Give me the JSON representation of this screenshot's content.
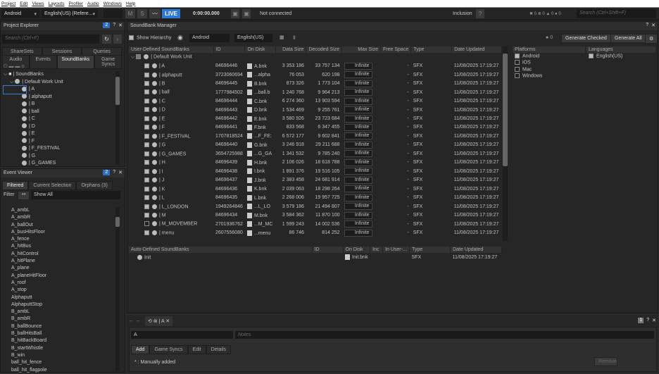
{
  "menu": [
    "Project",
    "Edit",
    "Views",
    "Layouts",
    "Profiler",
    "Audio",
    "Windows",
    "Help"
  ],
  "toolbar": {
    "platform": "Android",
    "language": "English(US) (Refere...",
    "m": "M",
    "s": "S",
    "live": "LIVE",
    "time": "0:00:00.000",
    "status": "Not connected",
    "inclusion": "Inclusion",
    "inclusion_btn": "?",
    "counts": [
      "0",
      "0",
      "0",
      "0"
    ],
    "search_placeholder": "Search (Ctrl+Shift+F)"
  },
  "project_explorer": {
    "title": "Project Explorer",
    "badge": "2",
    "search_placeholder": "Search (Ctrl+F)",
    "tabs_row1": [
      "ShareSets",
      "Sessions",
      "Queries"
    ],
    "tabs_row2": [
      "Audio",
      "Events",
      "SoundBanks",
      "Game Syncs"
    ],
    "active_tab": "SoundBanks",
    "root": "SoundBanks",
    "work_unit": "Default Work Unit",
    "items": [
      "A",
      "alphaputt",
      "B",
      "ball",
      "C",
      "D",
      "E",
      "F",
      "F_FESTIVAL",
      "G",
      "G_GAMES"
    ]
  },
  "event_viewer": {
    "title": "Event Viewer",
    "badge": "2",
    "tabs": [
      "Filtered",
      "Current Selection",
      "Orphans (3)"
    ],
    "filter_label": "Filter",
    "filter_btn": "**",
    "filter_value": "Show All",
    "events": [
      "A_ambL",
      "A_ambR",
      "A_ballOut",
      "A_busHitsFloor",
      "A_fence",
      "A_hitBus",
      "A_hitControl",
      "A_hitPlane",
      "A_plane",
      "A_planeHitFloor",
      "A_roof",
      "A_stop",
      "Alphaputt",
      "AlphaputtStop",
      "B_ambL",
      "B_ambR",
      "B_ballBounce",
      "B_ballHitsBall",
      "B_hitBackBoard",
      "B_startWhistle",
      "B_win",
      "ball_hit_fence",
      "ball_hit_flagpole"
    ]
  },
  "soundbank_manager": {
    "title": "SoundBank Manager",
    "show_hierarchy": "Show Hierarchy",
    "platform": "Android",
    "language": "English(US)",
    "info_count": "0",
    "generate_checked": "Generate Checked",
    "generate_all": "Generate All",
    "columns": [
      "User-Defined SoundBanks",
      "ID",
      "On Disk",
      "Data Size",
      "Decoded Size",
      "Max Size",
      "Free Space",
      "Type",
      "Date Updated"
    ],
    "work_unit": "Default Work Unit",
    "rows": [
      [
        "A",
        "84696446",
        "A.bnk",
        "3 353 186",
        "33 757 134",
        true
      ],
      [
        "alphaputt",
        "3723060694",
        "...alpha",
        "76 053",
        "620 198",
        true
      ],
      [
        "B",
        "84696445",
        "B.bnk",
        "873 326",
        "1 773 104",
        true
      ],
      [
        "ball",
        "1777984502",
        "...ball.b",
        "1 240 768",
        "9 964 213",
        true
      ],
      [
        "C",
        "84696444",
        "C.bnk",
        "6 274 360",
        "13 903 594",
        true
      ],
      [
        "D",
        "84696443",
        "D.bnk",
        "1 534 469",
        "9 255 761",
        true
      ],
      [
        "E",
        "84696442",
        "E.bnk",
        "3 580 926",
        "23 723 684",
        true
      ],
      [
        "F",
        "84696441",
        "F.bnk",
        "833 568",
        "6 347 455",
        true
      ],
      [
        "F_FESTIVAL",
        "1707818524",
        "...F_FE:",
        "6 572 177",
        "9 602 841",
        true
      ],
      [
        "G",
        "84696440",
        "G.bnk",
        "3 246 918",
        "29 211 688",
        true
      ],
      [
        "G_GAMES",
        "3654725988",
        "...G_GA",
        "1 341 532",
        "9 785 240",
        true
      ],
      [
        "H",
        "84696439",
        "H.bnk",
        "2 106 026",
        "18 618 788",
        true
      ],
      [
        "I",
        "84696438",
        "I.bnk",
        "1 891 376",
        "19 516 105",
        true
      ],
      [
        "J",
        "84696437",
        "J.bnk",
        "2 383 458",
        "24 681 914",
        true
      ],
      [
        "K",
        "84696436",
        "K.bnk",
        "2 039 063",
        "18 298 264",
        true
      ],
      [
        "L",
        "84696435",
        "L.bnk",
        "2 268 006",
        "19 957 725",
        true
      ],
      [
        "L_LONDON",
        "1949264846",
        "...L_LO",
        "3 579 186",
        "21 494 807",
        true
      ],
      [
        "M",
        "84696434",
        "M.bnk",
        "3 584 362",
        "11 870 100",
        true
      ],
      [
        "M_MOVEMBER",
        "2701936762",
        "...M_MC",
        "1 599 243",
        "14 002 536",
        false
      ],
      [
        "menu",
        "2607556080",
        "...menu",
        "86 746",
        "814 252",
        true
      ]
    ],
    "max_size": "Infinite",
    "free_space": "-",
    "type": "SFX",
    "date": "11/08/2025 17:19:27",
    "auto_columns": [
      "Auto-Defined SoundBanks",
      "ID",
      "On Disk",
      "Inc",
      "In User-...",
      "Type",
      "Date Updated"
    ],
    "auto_rows": [
      {
        "name": "Init",
        "file": "Init.bnk",
        "type": "SFX",
        "date": "11/08/2025 17:19:27"
      }
    ],
    "platforms_title": "Platforms",
    "platforms": [
      {
        "name": "Android",
        "checked": true
      },
      {
        "name": "iOS",
        "checked": false
      },
      {
        "name": "Mac",
        "checked": false
      },
      {
        "name": "Windows",
        "checked": false
      }
    ],
    "languages_title": "Languages",
    "languages": [
      {
        "name": "English(US)",
        "checked": true
      }
    ]
  },
  "property_editor": {
    "tab_label": "A",
    "badge": "1",
    "name_value": "A",
    "notes_placeholder": "Notes",
    "tabs": [
      "Add",
      "Game Syncs",
      "Edit",
      "Details"
    ],
    "legend": "* : Manually added",
    "remove": "Remove"
  }
}
